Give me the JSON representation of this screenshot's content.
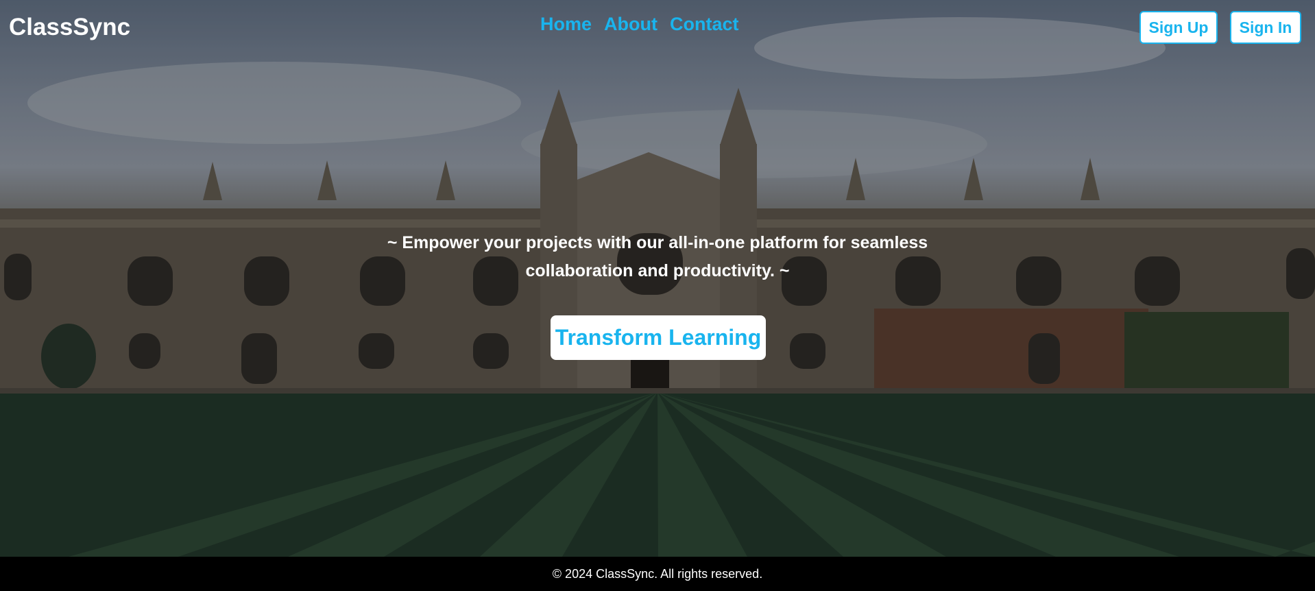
{
  "header": {
    "brand": "ClassSync",
    "nav": {
      "home": "Home",
      "about": "About",
      "contact": "Contact"
    },
    "signup_label": "Sign Up",
    "signin_label": "Sign In"
  },
  "hero": {
    "tagline_line1": "~ Empower your projects with our all-in-one platform for seamless",
    "tagline_line2": "collaboration and productivity. ~",
    "cta_label": "Transform Learning"
  },
  "footer": {
    "text": "© 2024 ClassSync. All rights reserved."
  },
  "colors": {
    "accent": "#19b4ee",
    "footer_bg": "#000000",
    "text": "#ffffff"
  }
}
